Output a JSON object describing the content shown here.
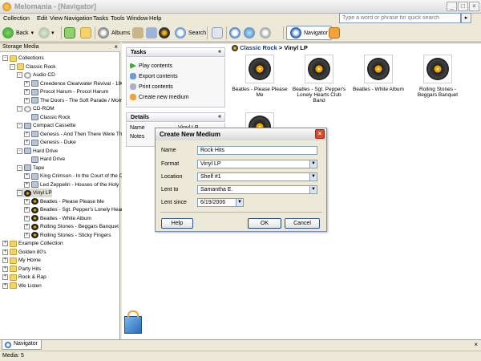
{
  "window": {
    "title": "Melomania - [Navigator]"
  },
  "menu": {
    "items": [
      "Collection",
      "Edit",
      "View",
      "Navigation",
      "Tasks",
      "Tools",
      "Window",
      "Help"
    ]
  },
  "quick_search": {
    "placeholder": "Type a word or phrase for quick search"
  },
  "toolbar": {
    "back": "Back",
    "albums": "Albums",
    "search": "Search",
    "navigator": "Navigator"
  },
  "left_panel": {
    "title": "Storage Media",
    "tree": [
      {
        "label": "Collections",
        "level": 0,
        "icon": "folder",
        "toggle": "-"
      },
      {
        "label": "Classic Rock",
        "level": 1,
        "icon": "folder",
        "toggle": "-"
      },
      {
        "label": "Audio CD",
        "level": 2,
        "icon": "disc",
        "toggle": "-"
      },
      {
        "label": "Creedence Clearwater Revival - 196",
        "level": 3,
        "icon": "media",
        "toggle": "+"
      },
      {
        "label": "Procol Harum - Procol Harum",
        "level": 3,
        "icon": "media",
        "toggle": "+"
      },
      {
        "label": "The Doors - The Soft Parade / Morri",
        "level": 3,
        "icon": "media",
        "toggle": "+"
      },
      {
        "label": "CD-ROM",
        "level": 2,
        "icon": "disc",
        "toggle": "-"
      },
      {
        "label": "Classic Rock",
        "level": 3,
        "icon": "media",
        "toggle": ""
      },
      {
        "label": "Compact Cassette",
        "level": 2,
        "icon": "media",
        "toggle": "-"
      },
      {
        "label": "Genesis - And Then There Were Thr",
        "level": 3,
        "icon": "media",
        "toggle": "+"
      },
      {
        "label": "Genesis - Duke",
        "level": 3,
        "icon": "media",
        "toggle": "+"
      },
      {
        "label": "Hard Drive",
        "level": 2,
        "icon": "media",
        "toggle": "-"
      },
      {
        "label": "Hard Drive",
        "level": 3,
        "icon": "media",
        "toggle": ""
      },
      {
        "label": "Tape",
        "level": 2,
        "icon": "media",
        "toggle": "-"
      },
      {
        "label": "King Crimson - In the Court of the C",
        "level": 3,
        "icon": "media",
        "toggle": "+"
      },
      {
        "label": "Led Zeppelin - Houses of the Holy",
        "level": 3,
        "icon": "media",
        "toggle": "+"
      },
      {
        "label": "Vinyl LP",
        "level": 2,
        "icon": "vinyl",
        "toggle": "-",
        "selected": true
      },
      {
        "label": "Beatles - Please Please Me",
        "level": 3,
        "icon": "vinyl",
        "toggle": "+"
      },
      {
        "label": "Beatles - Sgt. Pepper's Lonely Heart",
        "level": 3,
        "icon": "vinyl",
        "toggle": "+"
      },
      {
        "label": "Beatles - White Album",
        "level": 3,
        "icon": "vinyl",
        "toggle": "+"
      },
      {
        "label": "Rolling Stones - Beggars Banquet",
        "level": 3,
        "icon": "vinyl",
        "toggle": "+"
      },
      {
        "label": "Rolling Stones - Sticky Fingers",
        "level": 3,
        "icon": "vinyl",
        "toggle": "+"
      },
      {
        "label": "Example Collection",
        "level": 0,
        "icon": "folder",
        "toggle": "+"
      },
      {
        "label": "Golden 80's",
        "level": 0,
        "icon": "folder",
        "toggle": "+"
      },
      {
        "label": "My Home",
        "level": 0,
        "icon": "folder",
        "toggle": "+"
      },
      {
        "label": "Party Hits",
        "level": 0,
        "icon": "folder",
        "toggle": "+"
      },
      {
        "label": "Rock & Rap",
        "level": 0,
        "icon": "folder",
        "toggle": "+"
      },
      {
        "label": "We Listen",
        "level": 0,
        "icon": "folder",
        "toggle": "+"
      }
    ]
  },
  "tasks": {
    "title": "Tasks",
    "items": [
      "Play contents",
      "Export contents",
      "Print contents",
      "Create new medium"
    ]
  },
  "details": {
    "title": "Details",
    "name_label": "Name",
    "name_value": "Vinyl LP",
    "notes_label": "Notes"
  },
  "content": {
    "breadcrumb_root": "Classic Rock",
    "breadcrumb_sep": ">",
    "breadcrumb_current": "Vinyl LP",
    "tiles": [
      {
        "label": "Beatles - Please Please Me"
      },
      {
        "label": "Beatles - Sgt. Pepper's Lonely Hearts Club Band"
      },
      {
        "label": "Beatles - White Album"
      },
      {
        "label": "Rolling Stones - Beggars Banquet"
      },
      {
        "label": ""
      }
    ]
  },
  "bottom": {
    "nav_tab": "Navigator",
    "status": "Media: 5"
  },
  "dialog": {
    "title": "Create New Medium",
    "name_label": "Name",
    "name_value": "Rock Hits",
    "format_label": "Format",
    "format_value": "Vinyl LP",
    "location_label": "Location",
    "location_value": "Shelf #1",
    "lent_to_label": "Lent to",
    "lent_to_value": "Samantha E.",
    "lent_since_label": "Lent since",
    "lent_since_value": "6/19/2006",
    "help_label": "Help",
    "ok_label": "OK",
    "cancel_label": "Cancel"
  },
  "colors": {
    "accent": "#1b3b8c",
    "dialog_close": "#d84a2b",
    "vinyl_label": "#f2a400"
  }
}
